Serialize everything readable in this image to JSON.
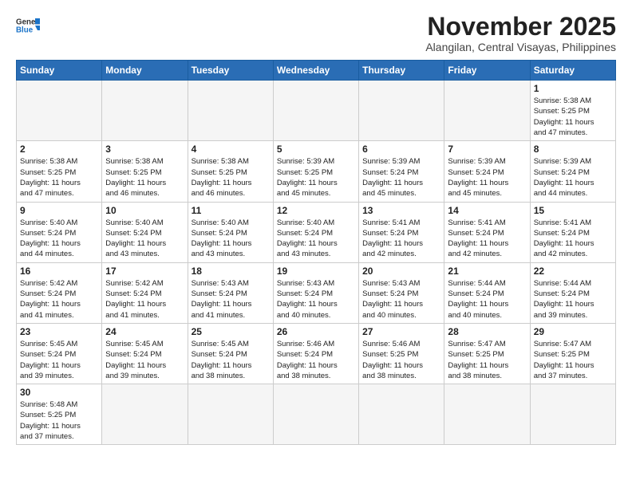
{
  "header": {
    "logo_general": "General",
    "logo_blue": "Blue",
    "month_title": "November 2025",
    "location": "Alangilan, Central Visayas, Philippines"
  },
  "weekdays": [
    "Sunday",
    "Monday",
    "Tuesday",
    "Wednesday",
    "Thursday",
    "Friday",
    "Saturday"
  ],
  "days": [
    {
      "date": "",
      "info": ""
    },
    {
      "date": "",
      "info": ""
    },
    {
      "date": "",
      "info": ""
    },
    {
      "date": "",
      "info": ""
    },
    {
      "date": "",
      "info": ""
    },
    {
      "date": "",
      "info": ""
    },
    {
      "date": "1",
      "info": "Sunrise: 5:38 AM\nSunset: 5:25 PM\nDaylight: 11 hours\nand 47 minutes."
    },
    {
      "date": "2",
      "info": "Sunrise: 5:38 AM\nSunset: 5:25 PM\nDaylight: 11 hours\nand 47 minutes."
    },
    {
      "date": "3",
      "info": "Sunrise: 5:38 AM\nSunset: 5:25 PM\nDaylight: 11 hours\nand 46 minutes."
    },
    {
      "date": "4",
      "info": "Sunrise: 5:38 AM\nSunset: 5:25 PM\nDaylight: 11 hours\nand 46 minutes."
    },
    {
      "date": "5",
      "info": "Sunrise: 5:39 AM\nSunset: 5:25 PM\nDaylight: 11 hours\nand 45 minutes."
    },
    {
      "date": "6",
      "info": "Sunrise: 5:39 AM\nSunset: 5:24 PM\nDaylight: 11 hours\nand 45 minutes."
    },
    {
      "date": "7",
      "info": "Sunrise: 5:39 AM\nSunset: 5:24 PM\nDaylight: 11 hours\nand 45 minutes."
    },
    {
      "date": "8",
      "info": "Sunrise: 5:39 AM\nSunset: 5:24 PM\nDaylight: 11 hours\nand 44 minutes."
    },
    {
      "date": "9",
      "info": "Sunrise: 5:40 AM\nSunset: 5:24 PM\nDaylight: 11 hours\nand 44 minutes."
    },
    {
      "date": "10",
      "info": "Sunrise: 5:40 AM\nSunset: 5:24 PM\nDaylight: 11 hours\nand 43 minutes."
    },
    {
      "date": "11",
      "info": "Sunrise: 5:40 AM\nSunset: 5:24 PM\nDaylight: 11 hours\nand 43 minutes."
    },
    {
      "date": "12",
      "info": "Sunrise: 5:40 AM\nSunset: 5:24 PM\nDaylight: 11 hours\nand 43 minutes."
    },
    {
      "date": "13",
      "info": "Sunrise: 5:41 AM\nSunset: 5:24 PM\nDaylight: 11 hours\nand 42 minutes."
    },
    {
      "date": "14",
      "info": "Sunrise: 5:41 AM\nSunset: 5:24 PM\nDaylight: 11 hours\nand 42 minutes."
    },
    {
      "date": "15",
      "info": "Sunrise: 5:41 AM\nSunset: 5:24 PM\nDaylight: 11 hours\nand 42 minutes."
    },
    {
      "date": "16",
      "info": "Sunrise: 5:42 AM\nSunset: 5:24 PM\nDaylight: 11 hours\nand 41 minutes."
    },
    {
      "date": "17",
      "info": "Sunrise: 5:42 AM\nSunset: 5:24 PM\nDaylight: 11 hours\nand 41 minutes."
    },
    {
      "date": "18",
      "info": "Sunrise: 5:43 AM\nSunset: 5:24 PM\nDaylight: 11 hours\nand 41 minutes."
    },
    {
      "date": "19",
      "info": "Sunrise: 5:43 AM\nSunset: 5:24 PM\nDaylight: 11 hours\nand 40 minutes."
    },
    {
      "date": "20",
      "info": "Sunrise: 5:43 AM\nSunset: 5:24 PM\nDaylight: 11 hours\nand 40 minutes."
    },
    {
      "date": "21",
      "info": "Sunrise: 5:44 AM\nSunset: 5:24 PM\nDaylight: 11 hours\nand 40 minutes."
    },
    {
      "date": "22",
      "info": "Sunrise: 5:44 AM\nSunset: 5:24 PM\nDaylight: 11 hours\nand 39 minutes."
    },
    {
      "date": "23",
      "info": "Sunrise: 5:45 AM\nSunset: 5:24 PM\nDaylight: 11 hours\nand 39 minutes."
    },
    {
      "date": "24",
      "info": "Sunrise: 5:45 AM\nSunset: 5:24 PM\nDaylight: 11 hours\nand 39 minutes."
    },
    {
      "date": "25",
      "info": "Sunrise: 5:45 AM\nSunset: 5:24 PM\nDaylight: 11 hours\nand 38 minutes."
    },
    {
      "date": "26",
      "info": "Sunrise: 5:46 AM\nSunset: 5:24 PM\nDaylight: 11 hours\nand 38 minutes."
    },
    {
      "date": "27",
      "info": "Sunrise: 5:46 AM\nSunset: 5:25 PM\nDaylight: 11 hours\nand 38 minutes."
    },
    {
      "date": "28",
      "info": "Sunrise: 5:47 AM\nSunset: 5:25 PM\nDaylight: 11 hours\nand 38 minutes."
    },
    {
      "date": "29",
      "info": "Sunrise: 5:47 AM\nSunset: 5:25 PM\nDaylight: 11 hours\nand 37 minutes."
    },
    {
      "date": "30",
      "info": "Sunrise: 5:48 AM\nSunset: 5:25 PM\nDaylight: 11 hours\nand 37 minutes."
    },
    {
      "date": "",
      "info": ""
    },
    {
      "date": "",
      "info": ""
    },
    {
      "date": "",
      "info": ""
    },
    {
      "date": "",
      "info": ""
    },
    {
      "date": "",
      "info": ""
    },
    {
      "date": "",
      "info": ""
    }
  ]
}
